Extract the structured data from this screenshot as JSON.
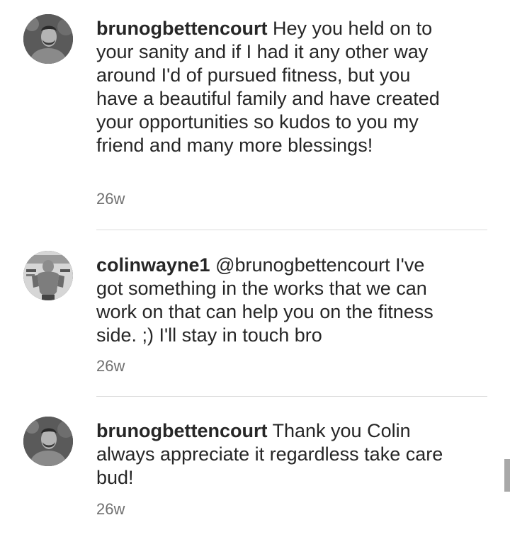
{
  "comments": [
    {
      "username": "brunogbettencourt",
      "text": "Hey you held on to your sanity and if I had it any other way around I'd of pursued fitness, but you have a beautiful family and have created your opportunities so kudos to you my friend and many more blessings!",
      "time": "26w",
      "avatar_icon": "profile-photo-man-beard"
    },
    {
      "username": "colinwayne1",
      "text": "@brunogbettencourt I've got something in the works that we can work on that can help you on the fitness side. ;) I'll stay in touch bro",
      "time": "26w",
      "avatar_icon": "profile-photo-fitness-magazine"
    },
    {
      "username": "brunogbettencourt",
      "text": "Thank you Colin always appreciate it regardless take care bud!",
      "time": "26w",
      "avatar_icon": "profile-photo-man-beard"
    }
  ],
  "colors": {
    "text": "#262626",
    "secondary": "#6f6f6f",
    "divider": "#dbdbdb"
  }
}
